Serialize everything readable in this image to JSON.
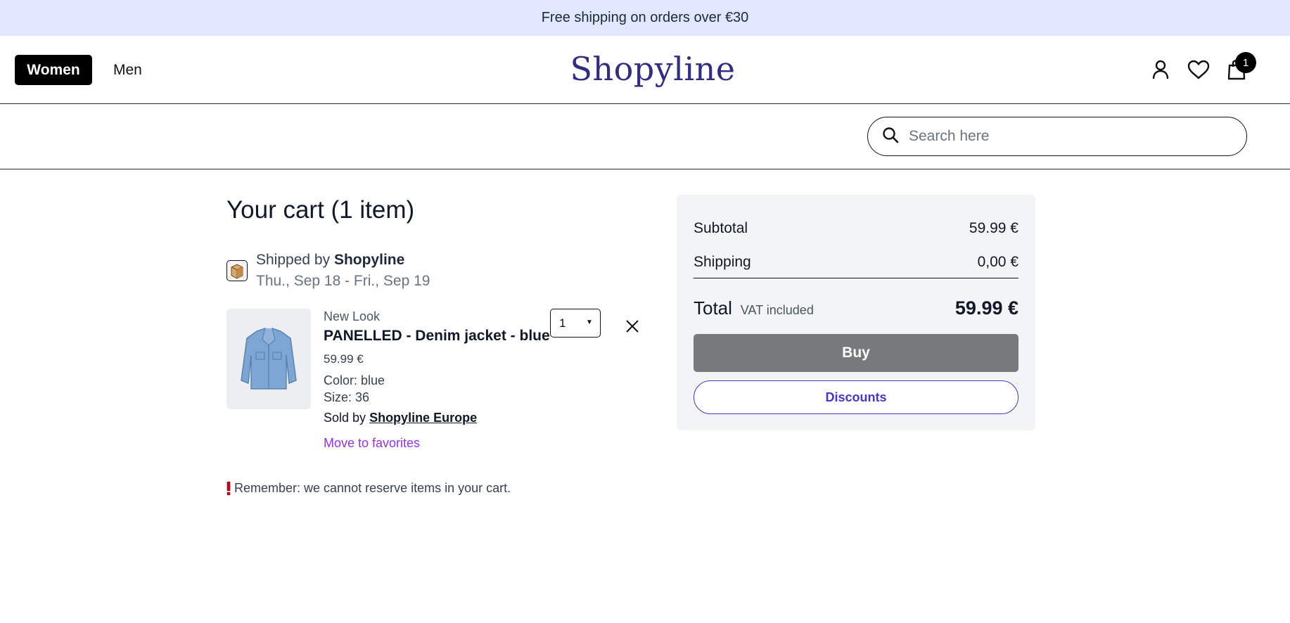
{
  "banner": {
    "text": "Free shipping on orders over €30"
  },
  "header": {
    "nav": {
      "women": "Women",
      "men": "Men"
    },
    "logo": "Shopyline",
    "icons": [
      "user-icon",
      "heart-icon",
      "shopping-bag-icon"
    ],
    "cart_count": "1"
  },
  "search": {
    "placeholder": "Search here",
    "value": ""
  },
  "cart": {
    "title": "Your cart (1 item)",
    "shipped_prefix": "Shipped by",
    "shipped_by": "Shopyline",
    "delivery_dates": "Thu., Sep 18 - Fri., Sep 19",
    "item": {
      "brand": "New Look",
      "name": "PANELLED - Denim jacket - blue",
      "price": "59.99 €",
      "color": "Color: blue",
      "size": "Size: 36",
      "sold_prefix": "Sold by",
      "seller": "Shopyline Europe",
      "move_to_favorites": "Move to favorites",
      "quantity": "1"
    },
    "reminder": "Remember: we cannot reserve items in your cart."
  },
  "summary": {
    "subtotal_label": "Subtotal",
    "subtotal_value": "59.99 €",
    "shipping_label": "Shipping",
    "shipping_value": "0,00 €",
    "total_label": "Total",
    "vat_note": "VAT included",
    "total_value": "59.99 €",
    "buy_label": "Buy",
    "discounts_label": "Discounts"
  },
  "colors": {
    "banner_bg": "#e0e7ff",
    "logo": "#312e81",
    "accent": "#4338ca",
    "favorites_link": "#9333ea",
    "buy_button": "#78797b"
  }
}
